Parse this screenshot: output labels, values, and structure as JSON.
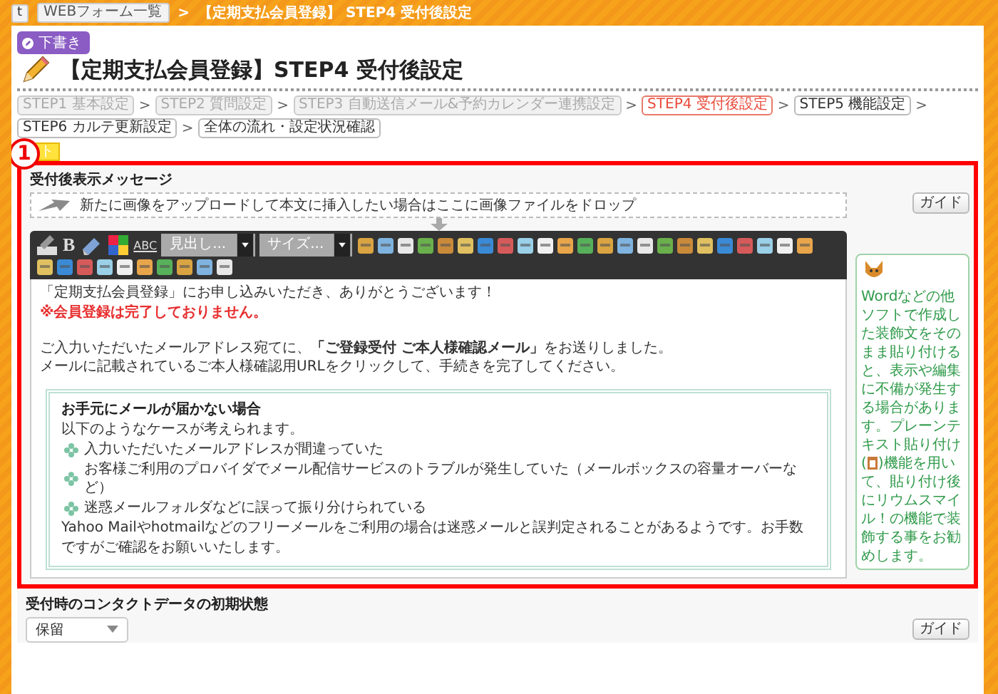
{
  "breadcrumb": {
    "home_label": "t",
    "items": [
      {
        "label": "WEBフォーム一覧",
        "kind": "link"
      },
      {
        "label": "【定期支払会員登録】 STEP4 受付後設定",
        "kind": "current"
      }
    ],
    "separator": ">"
  },
  "status_badge": "下書き",
  "page_title": "【定期支払会員登録】STEP4 受付後設定",
  "steps": [
    {
      "label": "STEP1 基本設定",
      "done": true,
      "selected": false
    },
    {
      "label": "STEP2 質問設定",
      "done": true,
      "selected": false
    },
    {
      "label": "STEP3 自動送信メール&予約カレンダー連携設定",
      "done": true,
      "selected": false
    },
    {
      "label": "STEP4 受付後設定",
      "done": false,
      "selected": true
    },
    {
      "label": "STEP5 機能設定",
      "done": false,
      "selected": false
    },
    {
      "label": "STEP6 カルテ更新設定",
      "done": false,
      "selected": false
    },
    {
      "label": "全体の流れ・設定状況確認",
      "done": false,
      "selected": false
    }
  ],
  "step_separator": ">",
  "hint_tag": "ト",
  "callout_number": "1",
  "message_section": {
    "title": "受付後表示メッセージ",
    "drop_zone": "新たに画像をアップロードして本文に挿入したい場合はここに画像ファイルをドロップ",
    "guide_button": "ガイド",
    "toolbar": {
      "labels": [
        "B",
        "ABC"
      ],
      "dropdowns": [
        "見出し...",
        "サイズ..."
      ]
    },
    "content": [
      {
        "kind": "normal",
        "text": "「定期支払会員登録」にお申し込みいただき、ありがとうございます！"
      },
      {
        "kind": "alert",
        "text": "※会員登録は完了しておりません。"
      },
      {
        "kind": "blank"
      },
      {
        "kind": "normal",
        "text": "ご入力いただいたメールアドレス宛てに、**「ご登録受付 ご本人様確認メール」**をお送りしました。"
      },
      {
        "kind": "normal",
        "text": "メールに記載されているご本人様確認用URLをクリックして、手続きを完了してください。"
      }
    ],
    "notice_box": {
      "heading": "お手元にメールが届かない場合",
      "intro": "以下のようなケースが考えられます。",
      "bullets": [
        "入力いただいたメールアドレスが間違っていた",
        "お客様ご利用のプロバイダでメール配信サービスのトラブルが発生していた（メールボックスの容量オーバーなど）",
        "迷惑メールフォルダなどに誤って振り分けられている"
      ],
      "closing": "Yahoo Mailやhotmailなどのフリーメールをご利用の場合は迷惑メールと誤判定されることがあるようです。お手数ですがご確認をお願いいたします。"
    },
    "tip": {
      "text_before": "Wordなどの他ソフトで作成した装飾文をそのまま貼り付けると、表示や編集に不備が発生する場合があります。プレーンテキスト貼り付け(",
      "text_after": ")機能を用いて、貼り付け後にリウムスマイル！の機能で装飾する事をお勧めします。"
    }
  },
  "contact_section": {
    "title": "受付時のコンタクトデータの初期状態",
    "select_value": "保留",
    "guide_button": "ガイド"
  }
}
